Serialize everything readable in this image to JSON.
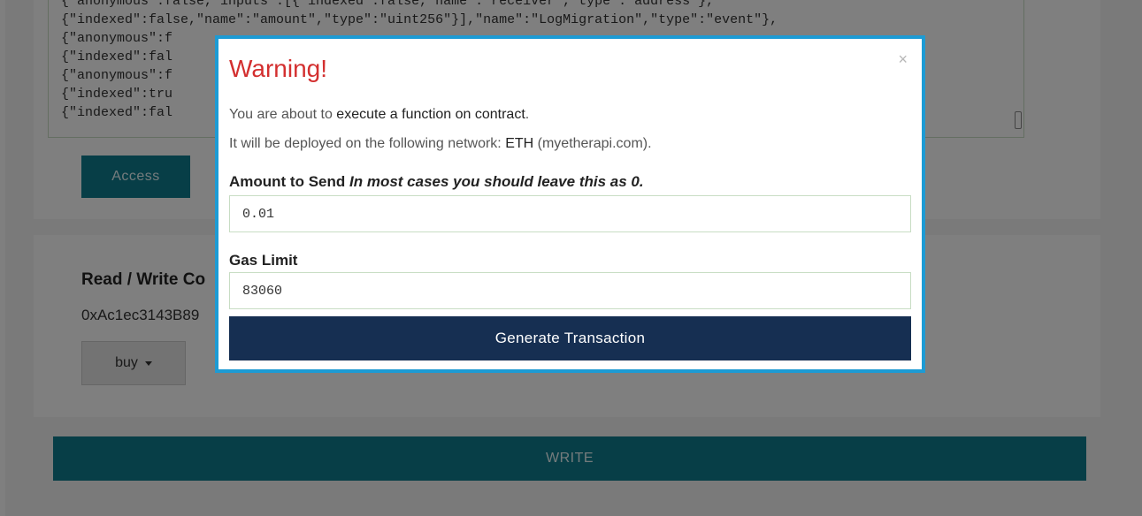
{
  "background": {
    "abi_lines": [
      "{\"anonymous\":false,\"inputs\":[{\"indexed\":false,\"name\":\"receiver\",\"type\":\"address\"},",
      "{\"indexed\":false,\"name\":\"amount\",\"type\":\"uint256\"}],\"name\":\"LogMigration\",\"type\":\"event\"},",
      "{\"anonymous\":f",
      "{\"indexed\":fal",
      "{\"anonymous\":f",
      "{\"indexed\":tru",
      "{\"indexed\":fal"
    ],
    "access_label": "Access",
    "rw_title": "Read / Write Co",
    "contract_address": "0xAc1ec3143B89",
    "function_select": "buy",
    "write_label": "WRITE"
  },
  "modal": {
    "title": "Warning!",
    "close_symbol": "×",
    "line1_prefix": "You are about to ",
    "line1_emph": "execute a function on contract",
    "line1_suffix": ".",
    "line2_prefix": "It will be deployed on the following network: ",
    "line2_network": "ETH",
    "line2_suffix": " (myetherapi.com).",
    "amount_label": "Amount to Send",
    "amount_hint": "In most cases you should leave this as 0.",
    "amount_value": "0.01",
    "gas_label": "Gas Limit",
    "gas_value": "83060",
    "generate_label": "Generate Transaction"
  },
  "colors": {
    "accent": "#0e7c8f",
    "modal_border": "#1d9bd4",
    "warning": "#d32f2f",
    "primary_button": "#162f52"
  }
}
